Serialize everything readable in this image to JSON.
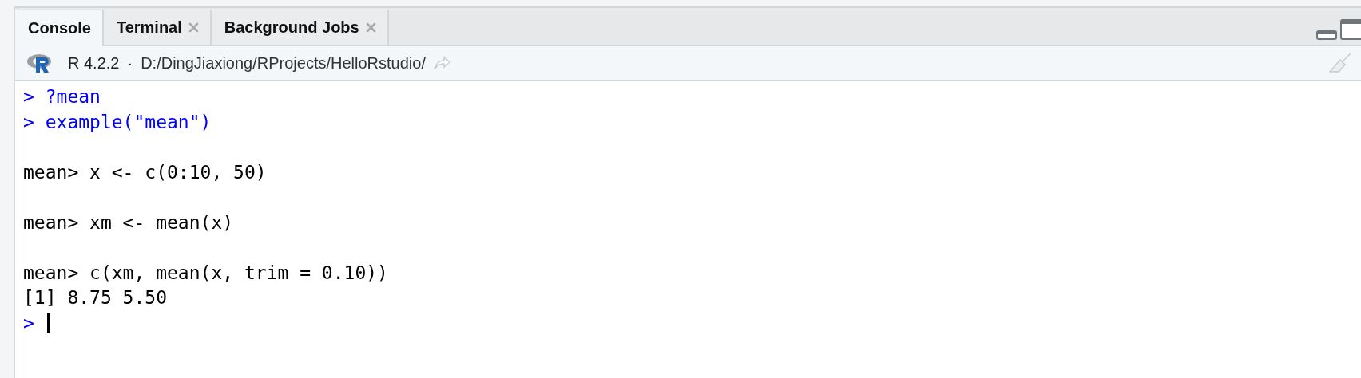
{
  "tabs": [
    {
      "label": "Console",
      "selected": true,
      "closable": false
    },
    {
      "label": "Terminal",
      "selected": false,
      "closable": true
    },
    {
      "label": "Background Jobs",
      "selected": false,
      "closable": true
    }
  ],
  "toolbar": {
    "version": "R 4.2.2",
    "separator": "·",
    "path": "D:/DingJiaxiong/RProjects/HelloRstudio/"
  },
  "console": {
    "lines": [
      {
        "kind": "command",
        "prompt": ">",
        "text": "?mean"
      },
      {
        "kind": "command",
        "prompt": ">",
        "text": "example(\"mean\")"
      },
      {
        "kind": "blank"
      },
      {
        "kind": "echo",
        "text": "mean> x <- c(0:10, 50)"
      },
      {
        "kind": "blank"
      },
      {
        "kind": "echo",
        "text": "mean> xm <- mean(x)"
      },
      {
        "kind": "blank"
      },
      {
        "kind": "echo",
        "text": "mean> c(xm, mean(x, trim = 0.10))"
      },
      {
        "kind": "output",
        "text": "[1] 8.75 5.50"
      },
      {
        "kind": "input",
        "prompt": ">"
      }
    ]
  }
}
